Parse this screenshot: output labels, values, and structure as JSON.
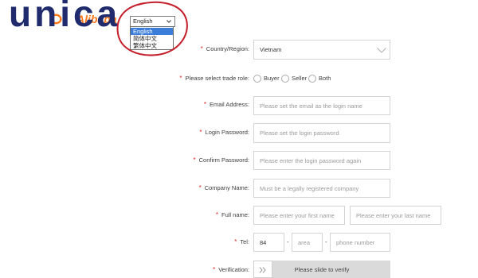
{
  "watermark": {
    "text": "unica"
  },
  "brand_logo": {
    "text": "Alibaba"
  },
  "language_select": {
    "selected": "English",
    "highlighted_index": 0,
    "options": [
      {
        "label": "English"
      },
      {
        "label": "简体中文"
      },
      {
        "label": "繁体中文"
      }
    ]
  },
  "form": {
    "required_mark": "*",
    "country": {
      "label": "Country/Region:",
      "value": "Vietnam"
    },
    "trade_role": {
      "label": "Please select trade role:",
      "options": [
        "Buyer",
        "Seller",
        "Both"
      ]
    },
    "email": {
      "label": "Email Address:",
      "placeholder": "Please set the email as the login name"
    },
    "login_password": {
      "label": "Login Password:",
      "placeholder": "Please set the login password"
    },
    "confirm_password": {
      "label": "Confirm Password:",
      "placeholder": "Please enter the login password again"
    },
    "company_name": {
      "label": "Company Name:",
      "placeholder": "Must be a legally registered company"
    },
    "full_name": {
      "label": "Full name:",
      "first_placeholder": "Please enter your first name",
      "last_placeholder": "Please enter your last name"
    },
    "tel": {
      "label": "Tel:",
      "country_code": "84",
      "separator": "-",
      "area_placeholder": "area",
      "phone_placeholder": "phone number"
    },
    "verification": {
      "label": "Verification:",
      "slider_text": "Please slide to verify"
    }
  },
  "icons": {
    "brand": "alibaba-smile-icon",
    "language_dropdown": "chevron-down-icon",
    "country_dropdown": "chevron-down-icon",
    "slider_handle": "double-chevron-right-icon"
  },
  "colors": {
    "required": "#e02424",
    "highlight": "#3b7dd8",
    "annotation": "#c41e2a",
    "watermark": "#1f2b6d",
    "brand": "#ff6a00"
  }
}
